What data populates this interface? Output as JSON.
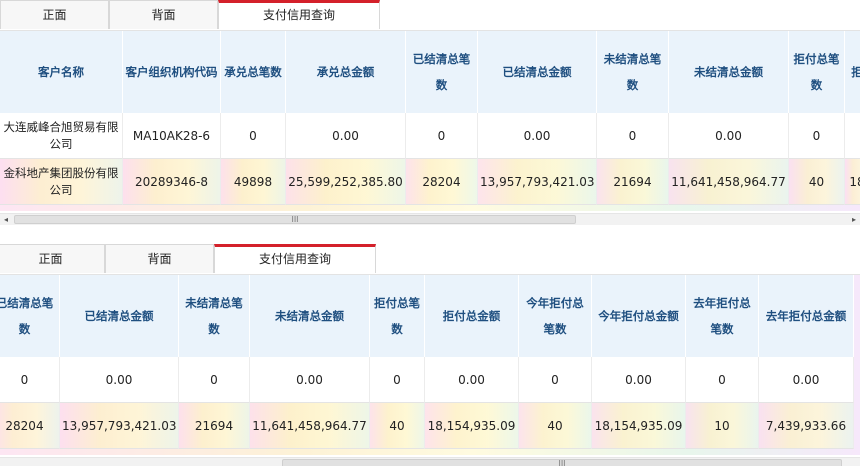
{
  "tabs": [
    "正面",
    "背面",
    "支付信用查询"
  ],
  "scroll_thumb_grip": "III",
  "icons": {
    "left_arrow": "◂",
    "right_arrow": "▸"
  },
  "panel1": {
    "headers": [
      "客户名称",
      "客户组织机构代码",
      "承兑总笔数",
      "承兑总金额",
      "已结清总笔数",
      "已结清总金额",
      "未结清总笔数",
      "未结清总金额",
      "拒付总笔数",
      "拒"
    ],
    "rows": [
      [
        "大连威峰合旭贸易有限公司",
        "MA10AK28-6",
        "0",
        "0.00",
        "0",
        "0.00",
        "0",
        "0.00",
        "0",
        ""
      ],
      [
        "金科地产集团股份有限公司",
        "20289346-8",
        "49898",
        "25,599,252,385.80",
        "28204",
        "13,957,793,421.03",
        "21694",
        "11,641,458,964.77",
        "40",
        "18"
      ]
    ]
  },
  "panel2": {
    "headers": [
      "已结清总笔数",
      "已结清总金额",
      "未结清总笔数",
      "未结清总金额",
      "拒付总笔数",
      "拒付总金额",
      "今年拒付总笔数",
      "今年拒付总金额",
      "去年拒付总笔数",
      "去年拒付总金额"
    ],
    "rows": [
      [
        "0",
        "0.00",
        "0",
        "0.00",
        "0",
        "0.00",
        "0",
        "0.00",
        "0",
        "0.00"
      ],
      [
        "28204",
        "13,957,793,421.03",
        "21694",
        "11,641,458,964.77",
        "40",
        "18,154,935.09",
        "40",
        "18,154,935.09",
        "10",
        "7,439,933.66"
      ]
    ]
  }
}
